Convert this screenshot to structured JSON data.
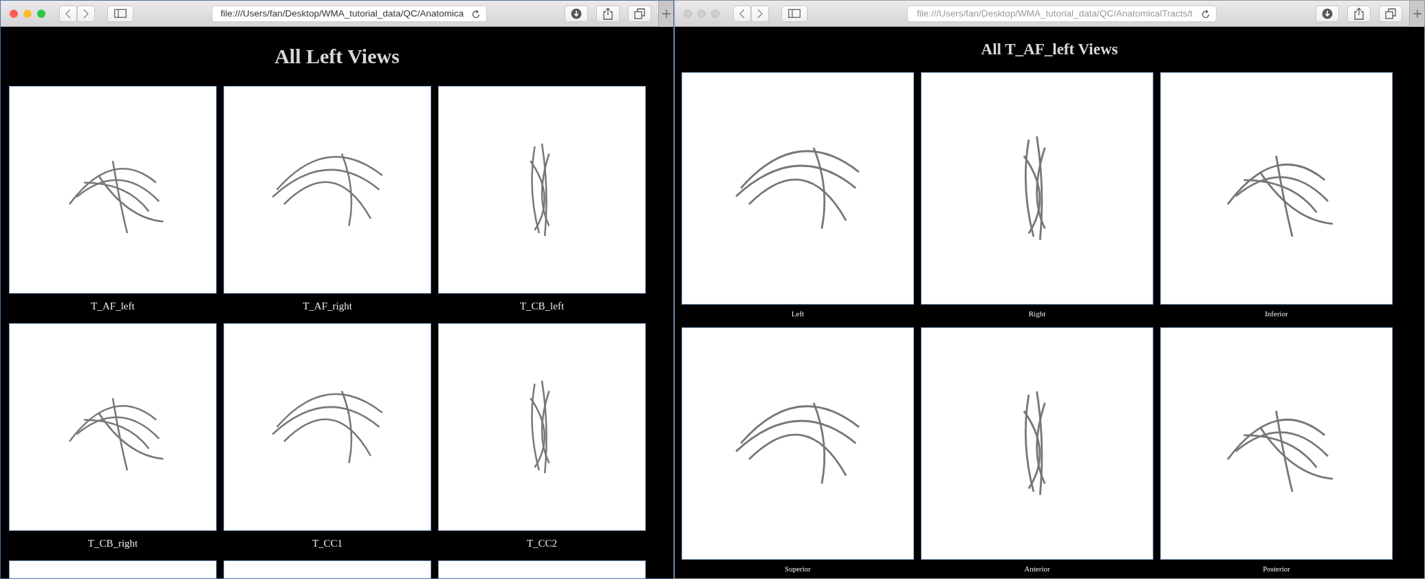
{
  "windows": [
    {
      "active": true,
      "kind": "large",
      "address": "file:///Users/fan/Desktop/WMA_tutorial_data/QC/Anatomica",
      "title": "All Left Views",
      "tiles": [
        {
          "kind": "full",
          "label": "T_AF_left"
        },
        {
          "kind": "full",
          "label": "T_AF_right"
        },
        {
          "kind": "full",
          "label": "T_CB_left"
        },
        {
          "kind": "full",
          "label": "T_CB_right"
        },
        {
          "kind": "full",
          "label": "T_CC1"
        },
        {
          "kind": "full",
          "label": "T_CC2"
        },
        {
          "kind": "partial"
        },
        {
          "kind": "partial"
        },
        {
          "kind": "partial"
        }
      ]
    },
    {
      "active": false,
      "kind": "small",
      "address": "file:///Users/fan/Desktop/WMA_tutorial_data/QC/AnatomicalTracts/t",
      "title": "All T_AF_left Views",
      "tiles": [
        {
          "kind": "full",
          "label": "Left"
        },
        {
          "kind": "full",
          "label": "Right"
        },
        {
          "kind": "full",
          "label": "Inferior"
        },
        {
          "kind": "full",
          "label": "Superior"
        },
        {
          "kind": "full",
          "label": "Anterior"
        },
        {
          "kind": "full",
          "label": "Posterior"
        }
      ]
    }
  ]
}
